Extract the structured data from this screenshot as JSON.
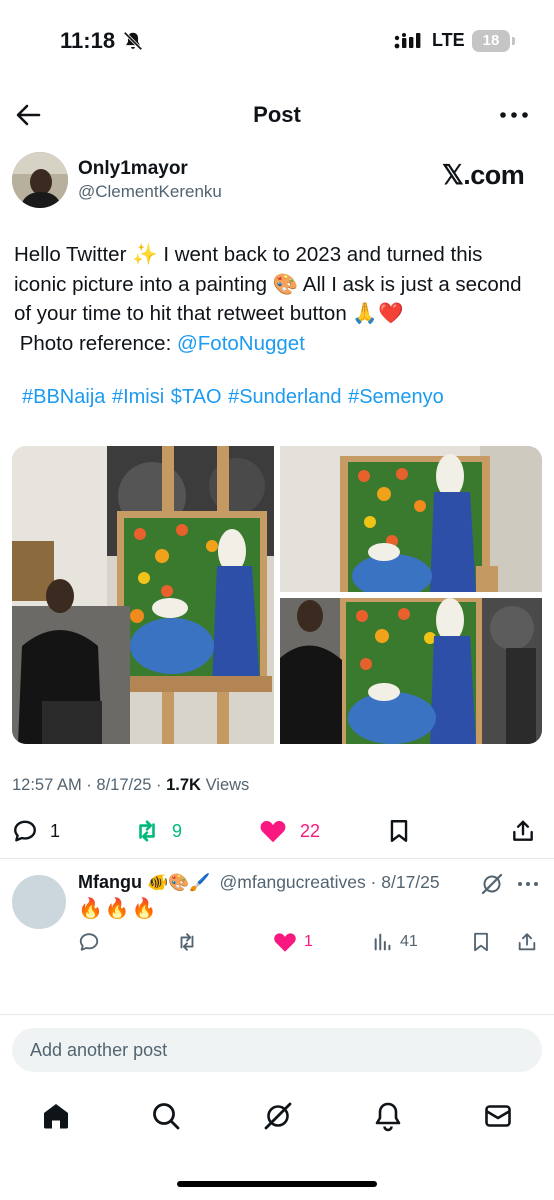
{
  "status_bar": {
    "time": "11:18",
    "network": "LTE",
    "battery": "18",
    "icons": [
      "bell-slash-icon",
      "signal-icon",
      "battery-icon"
    ]
  },
  "header": {
    "title": "Post",
    "icons": [
      "back-arrow-icon",
      "more-horizontal-icon"
    ]
  },
  "author": {
    "name": "Only1mayor",
    "handle": "@ClementKerenku",
    "brand": "𝕏.com"
  },
  "tweet": {
    "line1": "Hello Twitter ✨ I went back to 2023 and turned this",
    "line2": "iconic picture into a painting 🎨 All I ask is just a second",
    "line3": "of your time to hit that retweet button 🙏❤️",
    "line4_prefix": " Photo reference: ",
    "mention": "@FotoNugget",
    "hashtags": [
      "#BBNaija",
      "#Imisi",
      "$TAO",
      "#Sunderland",
      "#Semenyo"
    ]
  },
  "media": {
    "count": 3,
    "alt": [
      "painting-with-artist",
      "painting-on-easel",
      "artist-beside-painting"
    ]
  },
  "meta": {
    "time": "12:57 AM",
    "sep": " · ",
    "date": "8/17/25",
    "views_count": "1.7K",
    "views_label": " Views"
  },
  "actions": {
    "replies": "1",
    "retweets": "9",
    "likes": "22"
  },
  "reply": {
    "name": "Mfangu",
    "emojis": "🐠🎨🖌️",
    "handle_date": "@mfangucreatives · 8/17/25",
    "text": "🔥🔥🔥",
    "likes": "1",
    "views": "41"
  },
  "compose": {
    "placeholder": "Add another post"
  },
  "tabbar": {
    "items": [
      "home-icon",
      "search-icon",
      "grok-icon",
      "notifications-icon",
      "messages-icon"
    ]
  },
  "colors": {
    "accent": "#1d9bf0",
    "like": "#f91880",
    "retweet": "#00ba7c",
    "secondary_text": "#536471"
  }
}
